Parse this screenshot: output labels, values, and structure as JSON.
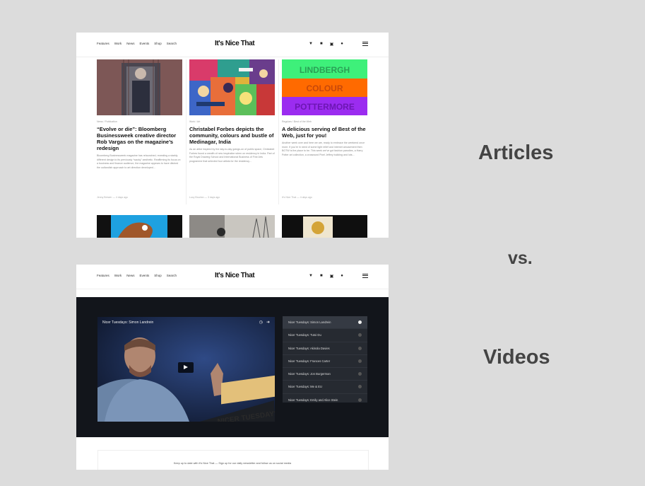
{
  "nav": {
    "links": [
      "Features",
      "Work",
      "News",
      "Events",
      "Shop",
      "Search"
    ],
    "logo": "It's Nice That",
    "social_icons": [
      "twitter-icon",
      "facebook-icon",
      "instagram-icon",
      "youtube-icon"
    ]
  },
  "articles": [
    {
      "category": "News / Publication",
      "title": "“Evolve or die”: Bloomberg Businessweek creative director Rob Vargas on the magazine’s redesign",
      "excerpt": "Bloomberg Businessweek magazine has relaunched, revealing a starkly different design to its previously “wacky” aesthetic. Reaffirming its focus on a business and finance audience, the magazine appears to have ditched the outlandish approach to art direction developed...",
      "meta": "Jenny Brewer — 4 days ago"
    },
    {
      "category": "Work / Art",
      "title": "Christabel Forbes depicts the community, colours and bustle of Medinagar, India",
      "excerpt": "As an artist inspired by the day-to-day goings-on of public space, Christabel Forbes found a wealth of new inspiration when on residency in India. Part of the Royal Drawing School and International Business of Fine Arts programme that selected four artists for the residency...",
      "meta": "Lucy Bourton — 3 days ago"
    },
    {
      "category": "Regulars / Best of the Web",
      "title": "A delicious serving of Best of the Web, just for you!",
      "excerpt": "Another week over and here we are, ready to embrace the weekend once more. If you’re in need of some light relief and internet amusement then BOTW is the place to be. This week we’ve got fashion parodies, a Harry Potter art collection, a crossword Pixel Jeffrey building and lots...",
      "meta": "It's Nice That — 4 days ago"
    }
  ],
  "poster_words": [
    "LINDBERGH",
    "COLOUR",
    "POTTERMORE"
  ],
  "labels": {
    "articles": "Articles",
    "vs": "vs.",
    "videos": "Videos"
  },
  "video": {
    "title": "Nicer Tuesdays: Simon Landrein",
    "podium_text": "NICER TUESDAYS",
    "playlist": [
      "Nicer Tuesdays: Simon Landrein",
      "Nicer Tuesdays: Tutoi Du",
      "Nicer Tuesdays: Akinola Davies",
      "Nicer Tuesdays: Frances Carter",
      "Nicer Tuesdays: Jon Burgerman",
      "Nicer Tuesdays: Me & EU",
      "Nicer Tuesdays: Emily and Alice Stein"
    ]
  },
  "newsletter": {
    "text": "Keep up to date with It's Nice That — Sign up for our daily newsletter and follow us on social media"
  },
  "colors": {
    "background": "#dcdcdc",
    "video_band": "#12151b",
    "poster_green": "#3ef07a",
    "poster_orange": "#ff6a00",
    "poster_purple": "#9b2cf0"
  }
}
